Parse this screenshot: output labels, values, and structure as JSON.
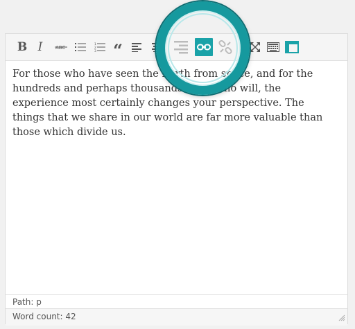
{
  "toolbar": {
    "bold_label": "B",
    "italic_label": "I",
    "quote_label": "“",
    "items": [
      {
        "name": "bold-icon"
      },
      {
        "name": "italic-icon"
      },
      {
        "name": "strikethrough-icon"
      },
      {
        "name": "bulleted-list-icon"
      },
      {
        "name": "numbered-list-icon"
      },
      {
        "name": "blockquote-icon"
      },
      {
        "name": "align-left-icon"
      },
      {
        "name": "align-center-icon"
      },
      {
        "name": "align-right-icon"
      },
      {
        "name": "insert-link-icon",
        "active": true
      },
      {
        "name": "remove-link-icon"
      },
      {
        "name": "fullscreen-icon"
      },
      {
        "name": "keyboard-toolbar-toggle-icon"
      },
      {
        "name": "distraction-free-icon"
      }
    ],
    "accent_color": "#1aa2a8"
  },
  "editor": {
    "content": "For those who have seen the Earth from space, and for the hundreds and perhaps thousands more who will, the experience most certainly changes your perspective. The things that we share in our world are far more valuable than those which divide us."
  },
  "status": {
    "path": "Path: p",
    "word_count": "Word count: 42"
  }
}
